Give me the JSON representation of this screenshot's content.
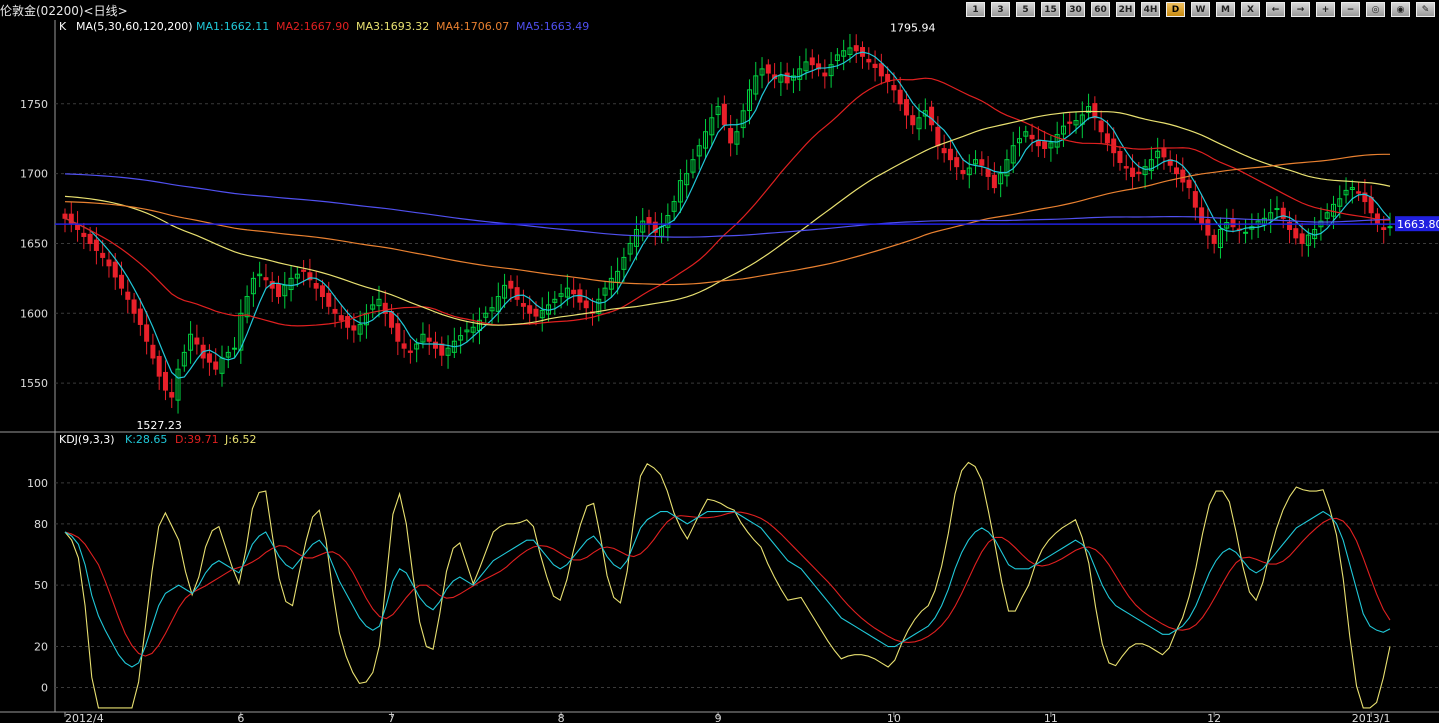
{
  "window": {
    "title": "伦敦金(02200)<日线>"
  },
  "toolbar": [
    {
      "label": "1",
      "icon": ""
    },
    {
      "label": "3",
      "icon": ""
    },
    {
      "label": "5",
      "icon": ""
    },
    {
      "label": "15",
      "icon": ""
    },
    {
      "label": "30",
      "icon": ""
    },
    {
      "label": "60",
      "icon": ""
    },
    {
      "label": "2H",
      "icon": ""
    },
    {
      "label": "4H",
      "icon": ""
    },
    {
      "label": "D",
      "icon": "",
      "active": true
    },
    {
      "label": "W",
      "icon": ""
    },
    {
      "label": "M",
      "icon": ""
    },
    {
      "label": "X",
      "icon": "close-icon"
    },
    {
      "label": "←",
      "icon": "arrow-left-icon"
    },
    {
      "label": "→",
      "icon": "arrow-right-icon"
    },
    {
      "label": "+",
      "icon": "zoom-in-icon"
    },
    {
      "label": "−",
      "icon": "zoom-out-icon"
    },
    {
      "label": "◎",
      "icon": "zoom-fit-icon"
    },
    {
      "label": "◉",
      "icon": "zoom-reset-icon"
    },
    {
      "label": "✎",
      "icon": "tool-icon"
    }
  ],
  "chart_data": [
    {
      "type": "candlestick",
      "legend_prefix": "K",
      "indicator_label": "MA(5,30,60,120,200)",
      "ma_legend": [
        {
          "name": "MA1",
          "value": "1662.11",
          "color": "#20c8d8"
        },
        {
          "name": "MA2",
          "value": "1667.90",
          "color": "#e02020"
        },
        {
          "name": "MA3",
          "value": "1693.32",
          "color": "#e8e070"
        },
        {
          "name": "MA4",
          "value": "1706.07",
          "color": "#e88030"
        },
        {
          "name": "MA5",
          "value": "1663.49",
          "color": "#5050f0"
        }
      ],
      "ylim": [
        1515,
        1810
      ],
      "y_ticks": [
        1550,
        1600,
        1650,
        1700,
        1750
      ],
      "x_ticks": [
        "2012/4",
        "6",
        "7",
        "8",
        "9",
        "10",
        "11",
        "12",
        "2013/1"
      ],
      "x_tick_index": [
        0,
        28,
        52,
        79,
        104,
        132,
        157,
        183,
        208
      ],
      "max_annotation": {
        "label": "1795.94",
        "index": 135
      },
      "min_annotation": {
        "label": "1527.23",
        "index": 15
      },
      "current_price": {
        "label": "1663.80",
        "value": 1663.8,
        "color": "#2020e0"
      },
      "up_color": "#00d040",
      "down_color": "#e8202a",
      "closes": [
        1668,
        1664,
        1660,
        1655,
        1650,
        1645,
        1640,
        1634,
        1626,
        1618,
        1610,
        1600,
        1592,
        1580,
        1568,
        1555,
        1545,
        1540,
        1560,
        1572,
        1585,
        1578,
        1568,
        1565,
        1560,
        1568,
        1572,
        1575,
        1600,
        1612,
        1625,
        1628,
        1624,
        1618,
        1612,
        1620,
        1625,
        1628,
        1630,
        1624,
        1618,
        1612,
        1605,
        1600,
        1595,
        1590,
        1588,
        1592,
        1600,
        1606,
        1610,
        1600,
        1590,
        1580,
        1575,
        1572,
        1578,
        1585,
        1580,
        1575,
        1570,
        1575,
        1580,
        1584,
        1588,
        1590,
        1595,
        1600,
        1604,
        1612,
        1620,
        1618,
        1610,
        1605,
        1600,
        1598,
        1602,
        1606,
        1610,
        1614,
        1618,
        1614,
        1608,
        1604,
        1600,
        1610,
        1618,
        1625,
        1630,
        1640,
        1650,
        1660,
        1666,
        1664,
        1658,
        1662,
        1670,
        1680,
        1695,
        1700,
        1710,
        1720,
        1730,
        1740,
        1748,
        1735,
        1722,
        1730,
        1745,
        1760,
        1770,
        1775,
        1772,
        1768,
        1770,
        1765,
        1770,
        1775,
        1780,
        1778,
        1775,
        1770,
        1778,
        1785,
        1788,
        1790,
        1788,
        1784,
        1780,
        1776,
        1770,
        1766,
        1760,
        1750,
        1742,
        1735,
        1740,
        1745,
        1735,
        1720,
        1715,
        1710,
        1705,
        1700,
        1704,
        1710,
        1706,
        1698,
        1690,
        1700,
        1710,
        1720,
        1725,
        1730,
        1725,
        1720,
        1718,
        1722,
        1728,
        1734,
        1736,
        1738,
        1742,
        1748,
        1740,
        1730,
        1722,
        1715,
        1708,
        1704,
        1698,
        1700,
        1705,
        1710,
        1716,
        1712,
        1706,
        1700,
        1694,
        1690,
        1676,
        1664,
        1656,
        1650,
        1660,
        1665,
        1662,
        1660,
        1658,
        1662,
        1666,
        1668,
        1672,
        1675,
        1668,
        1660,
        1654,
        1650,
        1656,
        1660,
        1666,
        1672,
        1678,
        1682,
        1688,
        1690,
        1686,
        1680,
        1672,
        1664,
        1660,
        1662
      ],
      "kdj_label": "KDJ(9,3,3)",
      "kdj_legend": [
        {
          "name": "K",
          "value": "28.65",
          "color": "#20c8d8"
        },
        {
          "name": "D",
          "value": "39.71",
          "color": "#e02020"
        },
        {
          "name": "J",
          "value": "6.52",
          "color": "#e8e070"
        }
      ],
      "kdj_ylim": [
        -12,
        120
      ],
      "kdj_y_ticks": [
        0,
        20,
        50,
        80,
        100
      ],
      "kdj_K": [
        76,
        74,
        70,
        60,
        45,
        35,
        28,
        22,
        16,
        12,
        10,
        12,
        20,
        30,
        40,
        46,
        48,
        50,
        48,
        46,
        50,
        56,
        60,
        62,
        60,
        58,
        56,
        62,
        70,
        74,
        76,
        70,
        64,
        60,
        58,
        62,
        66,
        70,
        72,
        68,
        60,
        52,
        46,
        40,
        34,
        30,
        28,
        30,
        40,
        52,
        58,
        56,
        50,
        44,
        40,
        38,
        42,
        48,
        52,
        54,
        52,
        50,
        54,
        58,
        62,
        64,
        66,
        68,
        70,
        72,
        72,
        68,
        64,
        60,
        58,
        60,
        64,
        68,
        72,
        74,
        70,
        64,
        60,
        58,
        62,
        70,
        78,
        82,
        84,
        86,
        86,
        84,
        82,
        80,
        82,
        84,
        86,
        86,
        86,
        86,
        86,
        84,
        82,
        80,
        78,
        74,
        70,
        66,
        62,
        60,
        58,
        54,
        50,
        46,
        42,
        38,
        34,
        32,
        30,
        28,
        26,
        24,
        22,
        20,
        20,
        22,
        24,
        26,
        28,
        30,
        34,
        40,
        48,
        58,
        66,
        72,
        76,
        78,
        76,
        72,
        66,
        60,
        58,
        58,
        58,
        60,
        62,
        64,
        66,
        68,
        70,
        72,
        70,
        66,
        58,
        50,
        44,
        40,
        38,
        36,
        34,
        32,
        30,
        28,
        26,
        26,
        28,
        30,
        34,
        40,
        48,
        56,
        62,
        66,
        68,
        66,
        62,
        58,
        56,
        58,
        62,
        66,
        70,
        74,
        78,
        80,
        82,
        84,
        86,
        84,
        80,
        72,
        60,
        48,
        36,
        30,
        28,
        27,
        28.65
      ]
    }
  ]
}
